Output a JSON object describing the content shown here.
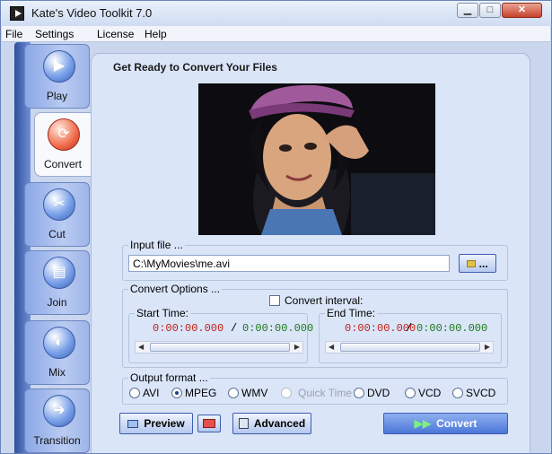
{
  "window": {
    "title": "Kate's Video Toolkit 7.0"
  },
  "menu": [
    "File",
    "Settings",
    "License",
    "Help"
  ],
  "sidebar": [
    {
      "label": "Play",
      "icon": "play-icon"
    },
    {
      "label": "Convert",
      "icon": "convert-icon",
      "active": true
    },
    {
      "label": "Cut",
      "icon": "scissors-icon"
    },
    {
      "label": "Join",
      "icon": "join-icon"
    },
    {
      "label": "Mix",
      "icon": "mix-icon"
    },
    {
      "label": "Transition",
      "icon": "transition-icon"
    }
  ],
  "main": {
    "heading": "Get Ready to Convert Your Files",
    "input_file": {
      "label": "Input file ...",
      "value": "C:\\MyMovies\\me.avi",
      "browse": "..."
    },
    "convert_options": {
      "label": "Convert Options ...",
      "interval_label": "Convert interval:",
      "start_label": "Start Time:",
      "start_value": "0:00:00.000",
      "start_separator": "/",
      "start_total": "0:00:00.000",
      "end_label": "End Time:",
      "end_value": "0:00:00.000",
      "end_separator": "/",
      "end_total": "0:00:00.000"
    },
    "output_format": {
      "label": "Output format ...",
      "options": [
        "AVI",
        "MPEG",
        "WMV",
        "Quick Time",
        "DVD",
        "VCD",
        "SVCD"
      ],
      "selected": "MPEG",
      "disabled": [
        "Quick Time"
      ]
    },
    "buttons": {
      "preview": "Preview",
      "advanced": "Advanced",
      "convert": "Convert"
    }
  }
}
